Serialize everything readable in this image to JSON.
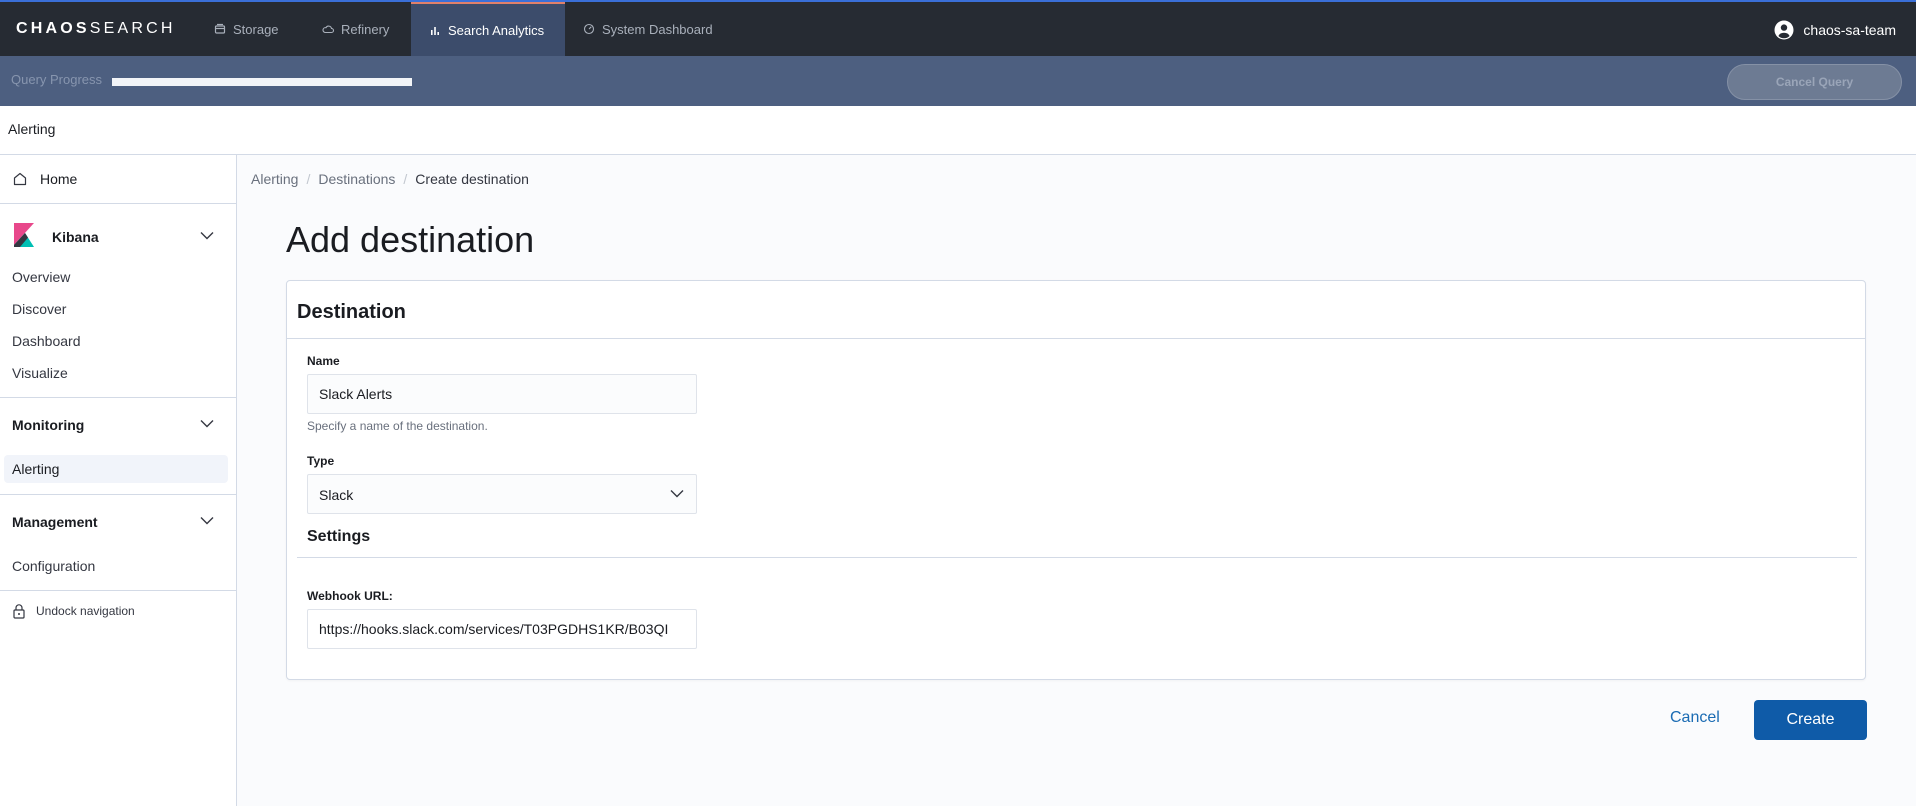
{
  "topnav": {
    "logo_bold": "CHAOS",
    "logo_rest": "SEARCH",
    "tabs": [
      {
        "label": "Storage",
        "icon": "storage-icon",
        "active": false
      },
      {
        "label": "Refinery",
        "icon": "cloud-icon",
        "active": false
      },
      {
        "label": "Search Analytics",
        "icon": "bar-chart-icon",
        "active": true
      },
      {
        "label": "System Dashboard",
        "icon": "gauge-icon",
        "active": false
      }
    ],
    "user": "chaos-sa-team"
  },
  "progress": {
    "label": "Query Progress",
    "fraction": 1.0,
    "cancel_label": "Cancel Query"
  },
  "app_header": {
    "title": "Alerting"
  },
  "sidebar": {
    "home": "Home",
    "groups": [
      {
        "title": "Kibana",
        "items": [
          "Overview",
          "Discover",
          "Dashboard",
          "Visualize"
        ]
      },
      {
        "title": "Monitoring",
        "items": [
          "Alerting"
        ]
      },
      {
        "title": "Management",
        "items": [
          "Configuration"
        ]
      }
    ],
    "selected": "Alerting",
    "undock": "Undock navigation"
  },
  "breadcrumbs": [
    "Alerting",
    "Destinations",
    "Create destination"
  ],
  "page_title": "Add destination",
  "panel": {
    "title": "Destination",
    "name_label": "Name",
    "name_value": "Slack Alerts",
    "name_help": "Specify a name of the destination.",
    "type_label": "Type",
    "type_value": "Slack",
    "settings_title": "Settings",
    "webhook_label": "Webhook URL:",
    "webhook_value": "https://hooks.slack.com/services/T03PGDHS1KR/B03QI"
  },
  "actions": {
    "cancel": "Cancel",
    "create": "Create"
  },
  "colors": {
    "nav_bg": "#262b33",
    "active_tab_bg": "#3c4c6b",
    "progress_bg": "#4d5f80",
    "primary": "#0f5ba8",
    "link": "#1a6bb3"
  }
}
